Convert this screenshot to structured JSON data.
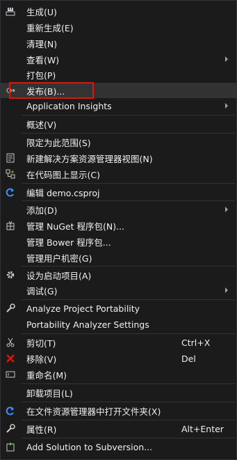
{
  "items": [
    {
      "label": "生成(U)",
      "icon": "build-icon"
    },
    {
      "label": "重新生成(E)"
    },
    {
      "label": "清理(N)"
    },
    {
      "label": "查看(W)",
      "submenu": true
    },
    {
      "label": "打包(P)"
    },
    {
      "label": "发布(B)...",
      "icon": "publish-icon"
    },
    {
      "label": "Application Insights",
      "submenu": true
    },
    {
      "label": "概述(V)"
    },
    {
      "label": "限定为此范围(S)"
    },
    {
      "label": "新建解决方案资源管理器视图(N)",
      "icon": "new-view-icon"
    },
    {
      "label": "在代码图上显示(C)",
      "icon": "code-map-icon"
    },
    {
      "label": "编辑 demo.csproj",
      "icon": "edit-refresh-icon"
    },
    {
      "label": "添加(D)",
      "submenu": true
    },
    {
      "label": "管理 NuGet 程序包(N)...",
      "icon": "nuget-icon"
    },
    {
      "label": "管理 Bower 程序包..."
    },
    {
      "label": "管理用户机密(G)"
    },
    {
      "label": "设为启动项目(A)",
      "icon": "gear-icon"
    },
    {
      "label": "调试(G)",
      "submenu": true
    },
    {
      "label": "Analyze Project Portability",
      "icon": "wrench-icon"
    },
    {
      "label": "Portability Analyzer Settings"
    },
    {
      "label": "剪切(T)",
      "shortcut": "Ctrl+X",
      "icon": "scissors-icon"
    },
    {
      "label": "移除(V)",
      "shortcut": "Del",
      "icon": "remove-icon"
    },
    {
      "label": "重命名(M)",
      "icon": "rename-icon"
    },
    {
      "label": "卸载项目(L)"
    },
    {
      "label": "在文件资源管理器中打开文件夹(X)",
      "icon": "open-folder-icon"
    },
    {
      "label": "属性(R)",
      "shortcut": "Alt+Enter",
      "icon": "properties-icon"
    },
    {
      "label": "Add Solution to Subversion...",
      "icon": "svn-icon"
    }
  ],
  "colors": {
    "menu_bg": "#1b1b1c",
    "hover_bg": "#333334",
    "highlight_border": "#e51400",
    "remove_icon": "#e51400",
    "refresh_icon": "#3794ff"
  }
}
